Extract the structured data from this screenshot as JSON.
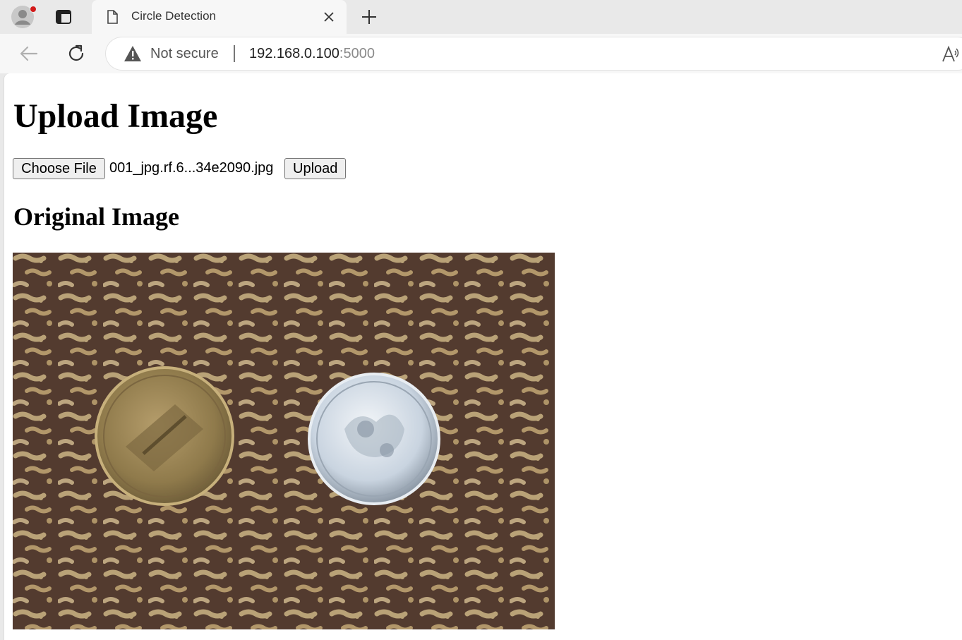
{
  "browser": {
    "tab": {
      "title": "Circle Detection"
    },
    "address": {
      "security_label": "Not secure",
      "host": "192.168.0.100",
      "port": ":5000"
    },
    "icons": [
      "profile-avatar-icon",
      "tab-actions-icon",
      "page-icon",
      "close-icon",
      "plus-icon",
      "back-arrow-icon",
      "reload-icon",
      "warning-icon",
      "read-aloud-icon"
    ]
  },
  "page": {
    "title": "Upload Image",
    "file_input": {
      "button_label": "Choose File",
      "selected_file": "001_jpg.rf.6...34e2090.jpg"
    },
    "upload_button": "Upload",
    "section_title": "Original Image"
  },
  "colors": {
    "notification_dot": "#d21a1a",
    "fabric_dark": "#5a4034",
    "fabric_light": "#d6bd8c",
    "coin_bronze": "#a08a5a",
    "coin_silver": "#c9d4e0"
  }
}
